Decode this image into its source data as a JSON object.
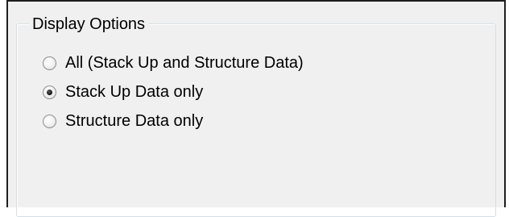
{
  "display_options": {
    "title": "Display Options",
    "options": [
      {
        "label": "All (Stack Up and Structure Data)",
        "checked": false
      },
      {
        "label": "Stack Up Data only",
        "checked": true
      },
      {
        "label": "Structure Data only",
        "checked": false
      }
    ]
  }
}
